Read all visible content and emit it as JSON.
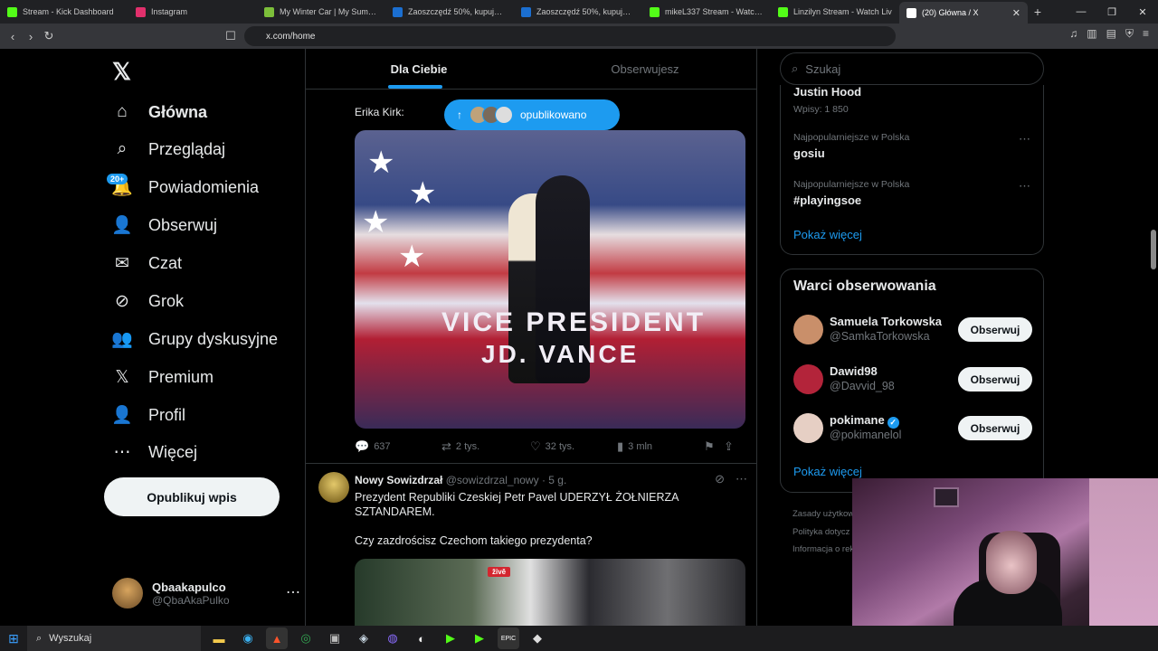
{
  "browser": {
    "tabs": [
      {
        "title": "Stream - Kick Dashboard",
        "color": "#53fc18"
      },
      {
        "title": "Instagram",
        "color": "#e1306c"
      },
      {
        "title": "My Winter Car | My Summer C",
        "color": "#7cbf3a"
      },
      {
        "title": "Zaoszczędź 50%, kupując Darts",
        "color": "#1b6fd1"
      },
      {
        "title": "Zaoszczędź 50%, kupując Darts",
        "color": "#1b6fd1"
      },
      {
        "title": "mikeL337 Stream - Watch L",
        "color": "#53fc18"
      },
      {
        "title": "Linzilyn Stream - Watch Liv",
        "color": "#53fc18"
      },
      {
        "title": "(20) Główna / X",
        "color": "#ffffff",
        "active": true
      }
    ],
    "url": "x.com/home"
  },
  "nav": {
    "logo": "𝕏",
    "items": [
      {
        "label": "Główna",
        "icon": "home-icon",
        "glyph": "⌂"
      },
      {
        "label": "Przeglądaj",
        "icon": "search-icon",
        "glyph": "⌕"
      },
      {
        "label": "Powiadomienia",
        "icon": "bell-icon",
        "glyph": "🔔"
      },
      {
        "label": "Obserwuj",
        "icon": "follow-icon",
        "glyph": "👤"
      },
      {
        "label": "Czat",
        "icon": "mail-icon",
        "glyph": "✉"
      },
      {
        "label": "Grok",
        "icon": "grok-icon",
        "glyph": "⊘"
      },
      {
        "label": "Grupy dyskusyjne",
        "icon": "community-icon",
        "glyph": "👥"
      },
      {
        "label": "Premium",
        "icon": "x-icon",
        "glyph": "𝕏"
      },
      {
        "label": "Profil",
        "icon": "profile-icon",
        "glyph": "👤"
      },
      {
        "label": "Więcej",
        "icon": "more-icon",
        "glyph": "⋯"
      }
    ],
    "notif_badge": "20+",
    "post_button": "Opublikuj wpis",
    "user": {
      "name": "Qbaakapulco",
      "handle": "@QbaAkaPulko"
    }
  },
  "feed": {
    "tabs": [
      "Dla Ciebie",
      "Obserwujesz"
    ],
    "quote_label": "Erika Kirk:",
    "new_posts_pill": "opublikowano",
    "image1": {
      "line1": "VICE PRESIDENT",
      "line2": "JD. VANCE"
    },
    "actions": {
      "replies": "637",
      "reposts": "2 tys.",
      "likes": "32 tys.",
      "views": "3 mln"
    },
    "tweet2": {
      "name": "Nowy Sowizdrzał",
      "handle": "@sowizdrzal_nowy",
      "time": "· 5 g.",
      "text1": "Prezydent Republiki Czeskiej Petr Pavel UDERZYŁ ŻOŁNIERZA SZTANDAREM.",
      "text2": "Czy zazdrościsz Czechom takiego prezydenta?",
      "live_badge": "živě"
    }
  },
  "sidebar": {
    "search_placeholder": "Szukaj",
    "trends": [
      {
        "meta": "",
        "name": "Justin Hood",
        "sub": "Wpisy: 1 850"
      },
      {
        "meta": "Najpopularniejsze w Polska",
        "name": "gosiu"
      },
      {
        "meta": "Najpopularniejsze w Polska",
        "name": "#playingsoe"
      }
    ],
    "show_more": "Pokaż więcej",
    "who_title": "Warci obserwowania",
    "who": [
      {
        "name": "Samuela Torkowska",
        "handle": "@SamkaTorkowska",
        "button": "Obserwuj",
        "color": "#c98f6a"
      },
      {
        "name": "Dawid98",
        "handle": "@Davvid_98",
        "button": "Obserwuj",
        "color": "#b3243a"
      },
      {
        "name": "pokimane",
        "handle": "@pokimanelol",
        "button": "Obserwuj",
        "color": "#e6cfc4",
        "verified": true
      }
    ],
    "who_more": "Pokaż więcej",
    "footer": [
      "Zasady użytkow",
      "Polityka dotycz",
      "Informacja o rek"
    ]
  },
  "taskbar": {
    "search": "Wyszukaj"
  }
}
